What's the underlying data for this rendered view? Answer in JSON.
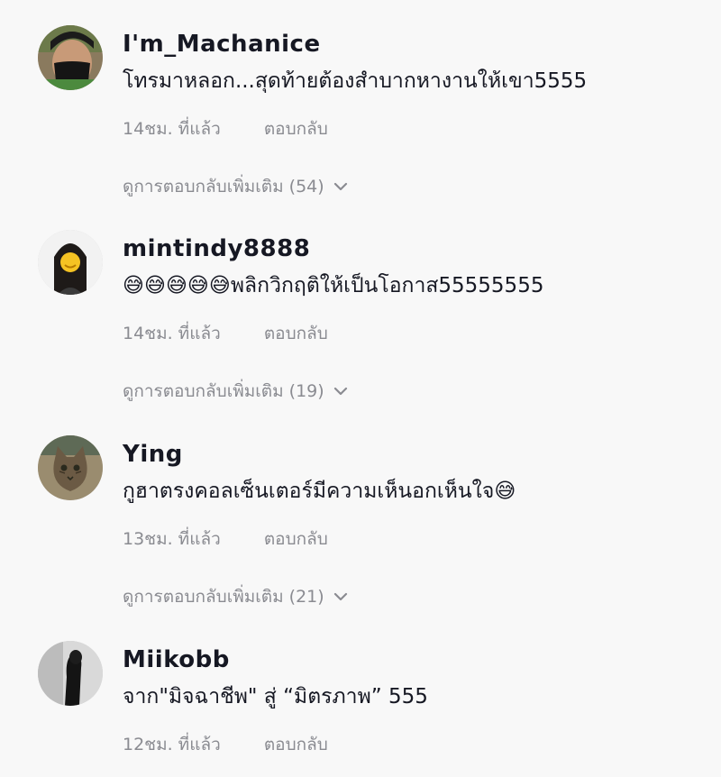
{
  "comments": [
    {
      "username": "I'm_Machanice",
      "text": "โทรมาหลอก...สุดท้ายต้องสำบากหางานให้เขา5555",
      "time": "14ชม. ที่แล้ว",
      "reply_label": "ตอบกลับ",
      "more_replies": "ดูการตอบกลับเพิ่มเติม (54)",
      "avatar": "man-with-black-mask-avatar"
    },
    {
      "username": "mintindy8888",
      "text": "😅😅😅😅😅พลิกวิกฤติให้เป็นโอกาส55555555",
      "time": "14ชม. ที่แล้ว",
      "reply_label": "ตอบกลับ",
      "more_replies": "ดูการตอบกลับเพิ่มเติม (19)",
      "avatar": "woman-with-emoji-face-avatar"
    },
    {
      "username": "Ying",
      "text": "กูฮาตรงคอลเซ็นเตอร์มีความเห็นอกเห็นใจ😅",
      "time": "13ชม. ที่แล้ว",
      "reply_label": "ตอบกลับ",
      "more_replies": "ดูการตอบกลับเพิ่มเติม (21)",
      "avatar": "cat-avatar"
    },
    {
      "username": "Miikobb",
      "text": "จาก\"มิจฉาชีพ\" สู่ “มิตรภาพ” 555",
      "time": "12ชม. ที่แล้ว",
      "reply_label": "ตอบกลับ",
      "avatar": "dark-silhouette-avatar"
    }
  ],
  "colors": {
    "background": "#f8f8f8",
    "username": "#161823",
    "meta": "#8a8b91"
  },
  "icons": {
    "expand": "chevron-down-icon"
  }
}
